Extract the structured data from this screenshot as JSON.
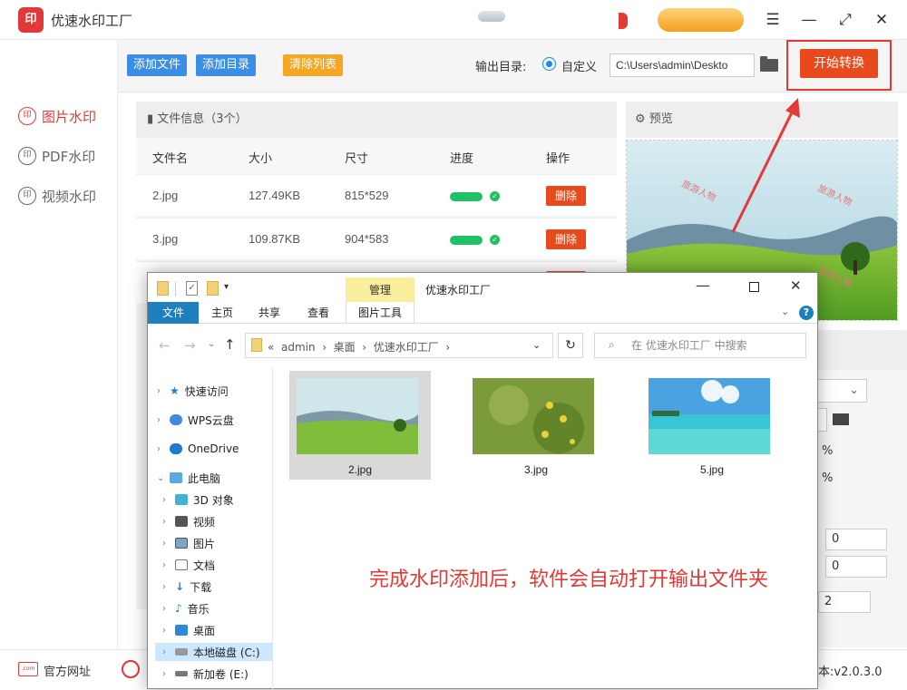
{
  "app": {
    "title": "优速水印工厂",
    "logo_text": "印"
  },
  "sidebar": {
    "items": [
      {
        "label": "图片水印",
        "active": true
      },
      {
        "label": "PDF水印",
        "active": false
      },
      {
        "label": "视频水印",
        "active": false
      }
    ]
  },
  "toolbar": {
    "add_file": "添加文件",
    "add_dir": "添加目录",
    "clear_list": "清除列表",
    "output_label": "输出目录:",
    "radio_label": "自定义",
    "path_value": "C:\\Users\\admin\\Deskto",
    "start_label": "开始转换"
  },
  "files": {
    "header": "文件信息（3个）",
    "columns": [
      "文件名",
      "大小",
      "尺寸",
      "进度",
      "操作"
    ],
    "rows": [
      {
        "name": "2.jpg",
        "size": "127.49KB",
        "dims": "815*529",
        "action": "删除"
      },
      {
        "name": "3.jpg",
        "size": "109.87KB",
        "dims": "904*583",
        "action": "删除"
      }
    ]
  },
  "preview": {
    "title": "预览",
    "watermark": "旅游人物"
  },
  "settings": {
    "values": [
      "0",
      "0",
      "2"
    ],
    "percent": "%"
  },
  "footer": {
    "website": "官方网址",
    "version": "本:v2.0.3.0"
  },
  "explorer": {
    "title": "优速水印工厂",
    "manage_tab": "管理",
    "picture_tools": "图片工具",
    "tabs": [
      "文件",
      "主页",
      "共享",
      "查看"
    ],
    "address": [
      "admin",
      "桌面",
      "优速水印工厂"
    ],
    "search_placeholder": "在 优速水印工厂 中搜索",
    "nav": [
      "快速访问",
      "WPS云盘",
      "OneDrive",
      "此电脑",
      "3D 对象",
      "视频",
      "图片",
      "文档",
      "下载",
      "音乐",
      "桌面",
      "本地磁盘 (C:)",
      "新加卷 (E:)"
    ],
    "files": [
      {
        "name": "2.jpg"
      },
      {
        "name": "3.jpg"
      },
      {
        "name": "5.jpg"
      }
    ]
  },
  "annotation": "完成水印添加后，软件会自动打开输出文件夹",
  "colors": {
    "accent": "#e53935",
    "blue": "#3a8ee6",
    "orange": "#f5a623",
    "progress": "#21c065"
  }
}
